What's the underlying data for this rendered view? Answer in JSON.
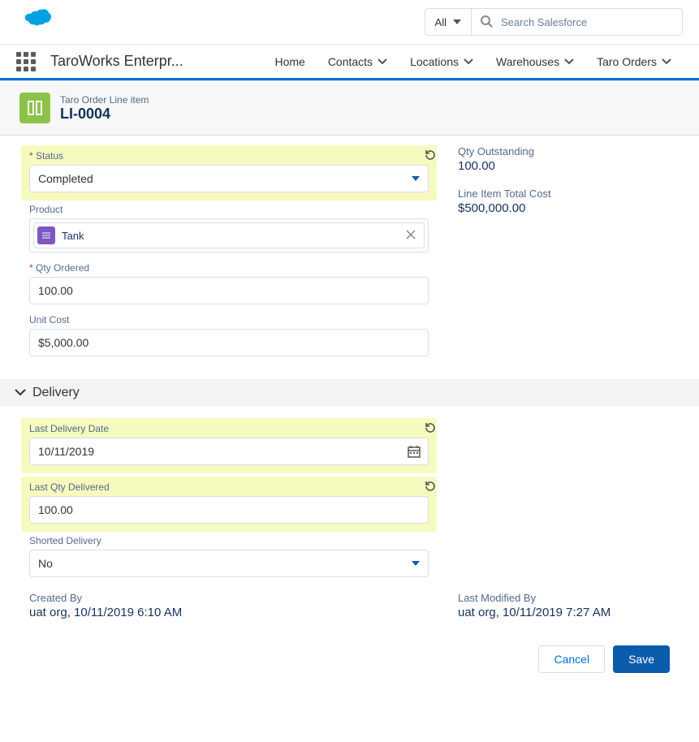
{
  "header": {
    "scope": "All",
    "search_placeholder": "Search Salesforce"
  },
  "nav": {
    "app_name": "TaroWorks Enterpr...",
    "items": [
      "Home",
      "Contacts",
      "Locations",
      "Warehouses",
      "Taro Orders"
    ]
  },
  "record": {
    "type": "Taro Order Line item",
    "title": "LI-0004"
  },
  "labels": {
    "status": "Status",
    "product": "Product",
    "qty_ordered": "Qty Ordered",
    "unit_cost": "Unit Cost",
    "qty_outstanding": "Qty Outstanding",
    "line_item_total": "Line Item Total Cost",
    "section_delivery": "Delivery",
    "last_delivery_date": "Last Delivery Date",
    "last_qty_delivered": "Last Qty Delivered",
    "shorted_delivery": "Shorted Delivery",
    "created_by": "Created By",
    "last_modified_by": "Last Modified By"
  },
  "values": {
    "status": "Completed",
    "product": "Tank",
    "qty_ordered": "100.00",
    "unit_cost": "$5,000.00",
    "qty_outstanding": "100.00",
    "line_item_total": "$500,000.00",
    "last_delivery_date": "10/11/2019",
    "last_qty_delivered": "100.00",
    "shorted_delivery": "No",
    "created_by": "uat org, 10/11/2019 6:10 AM",
    "last_modified_by": "uat org, 10/11/2019 7:27 AM"
  },
  "buttons": {
    "cancel": "Cancel",
    "save": "Save"
  }
}
